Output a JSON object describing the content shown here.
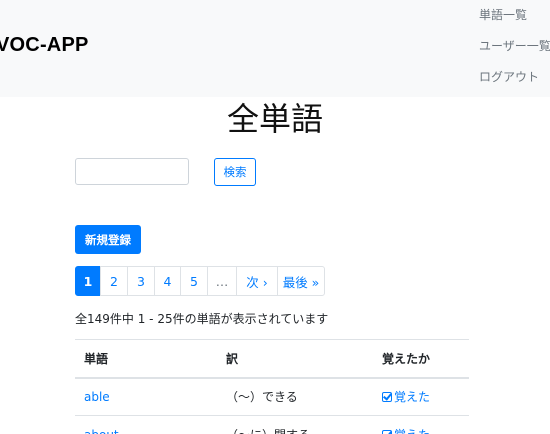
{
  "navbar": {
    "brand": "VOC-APP",
    "links": [
      "単語一覧",
      "ユーザー一覧",
      "ログアウト"
    ]
  },
  "main": {
    "title": "全単語",
    "search": {
      "value": "",
      "button_label": "検索"
    },
    "new_button_label": "新規登録",
    "pagination": [
      {
        "label": "1",
        "state": "active"
      },
      {
        "label": "2",
        "state": ""
      },
      {
        "label": "3",
        "state": ""
      },
      {
        "label": "4",
        "state": ""
      },
      {
        "label": "5",
        "state": ""
      },
      {
        "label": "…",
        "state": "disabled"
      },
      {
        "label": "次 ›",
        "state": ""
      },
      {
        "label": "最後 »",
        "state": ""
      }
    ],
    "summary": "全149件中 1 - 25件の単語が表示されています",
    "table": {
      "headers": [
        "単語",
        "訳",
        "覚えたか"
      ],
      "rows": [
        {
          "word": "able",
          "meaning": "（〜）できる",
          "remembered": "覚えた"
        },
        {
          "word": "about",
          "meaning": "（〜に）関する",
          "remembered": "覚えた"
        }
      ]
    }
  },
  "colors": {
    "primary": "#007bff",
    "navbar_bg": "#f8f9fa",
    "muted": "#6c757d",
    "border": "#dee2e6"
  },
  "icons": [
    "check-square-icon"
  ]
}
